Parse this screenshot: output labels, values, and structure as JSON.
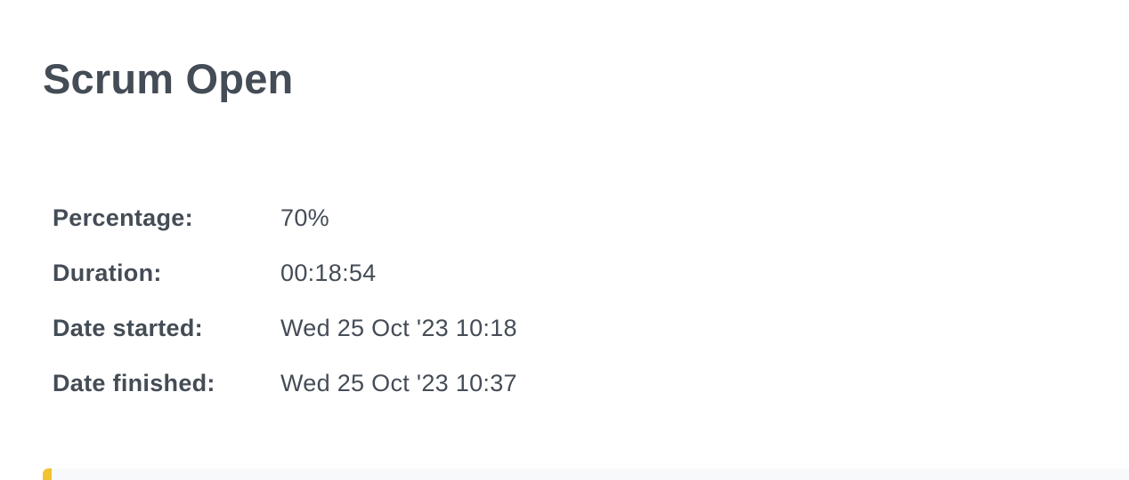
{
  "page": {
    "title": "Scrum Open"
  },
  "stats": {
    "percentage_label": "Percentage:",
    "percentage_value": "70%",
    "duration_label": "Duration:",
    "duration_value": "00:18:54",
    "date_started_label": "Date started:",
    "date_started_value": "Wed 25 Oct '23 10:18",
    "date_finished_label": "Date finished:",
    "date_finished_value": "Wed 25 Oct '23 10:37"
  },
  "colors": {
    "text": "#444c56",
    "accent": "#f1c232",
    "panel_background": "#f7f9fb"
  }
}
